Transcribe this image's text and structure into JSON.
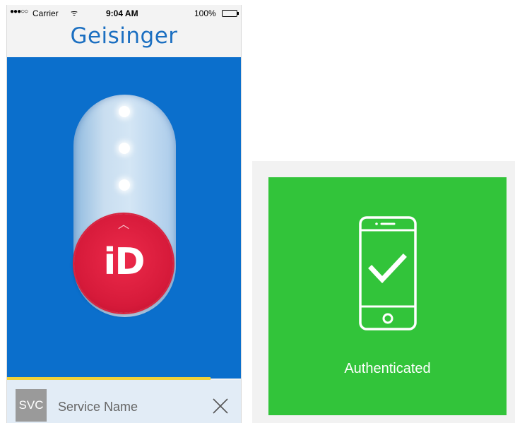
{
  "status_bar": {
    "signal": "●●●○○",
    "carrier": "Carrier",
    "wifi_glyph": "ᯤ",
    "time": "9:04 AM",
    "battery_percent": "100%"
  },
  "app": {
    "brand_title": "Geisinger",
    "brand_color": "#1b6fc1",
    "background_color": "#0b6fcc"
  },
  "slider": {
    "chevron": "︿",
    "button_label": "iD",
    "button_color": "#d61a3a"
  },
  "service": {
    "badge": "SVC",
    "name": "Service Name"
  },
  "auth": {
    "label": "Authenticated",
    "card_color": "#32c43a"
  },
  "icons": {
    "wifi": "wifi-icon",
    "battery": "battery-icon",
    "close": "close-icon",
    "phone_check": "smartphone-check-icon"
  }
}
